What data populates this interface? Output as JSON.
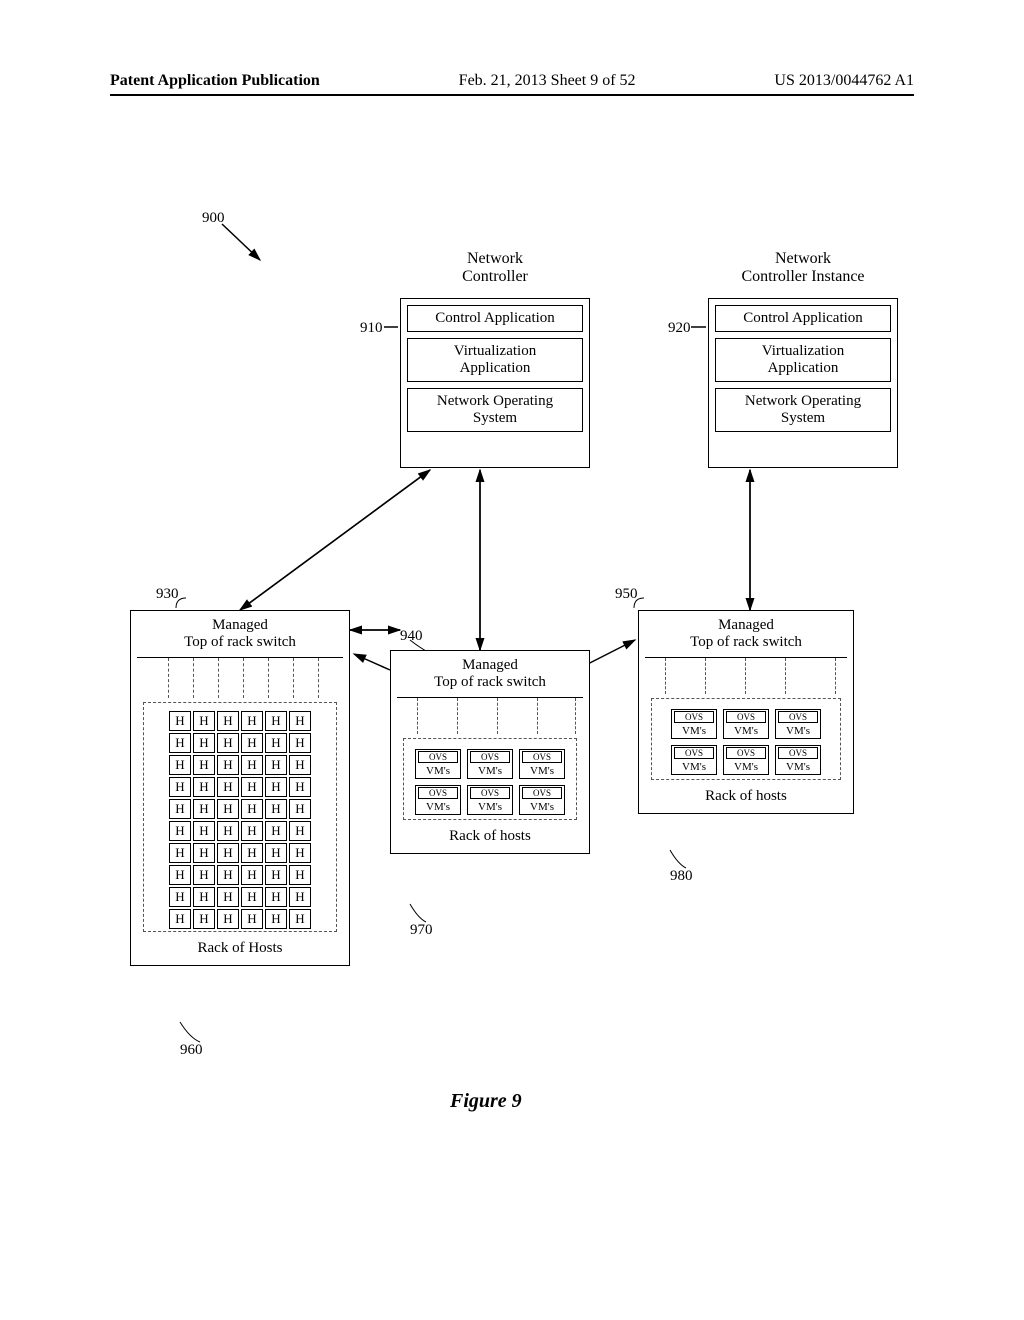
{
  "header": {
    "left": "Patent Application Publication",
    "center": "Feb. 21, 2013  Sheet 9 of 52",
    "right": "US 2013/0044762 A1"
  },
  "refnums": {
    "n900": "900",
    "n910": "910",
    "n920": "920",
    "n930": "930",
    "n940": "940",
    "n950": "950",
    "n960": "960",
    "n970": "970",
    "n980": "980"
  },
  "ctrl1": {
    "title": "Network\nController",
    "row1": "Control Application",
    "row2": "Virtualization\nApplication",
    "row3": "Network Operating\nSystem"
  },
  "ctrl2": {
    "title": "Network\nController Instance",
    "row1": "Control Application",
    "row2": "Virtualization\nApplication",
    "row3": "Network Operating\nSystem"
  },
  "sw930": {
    "title": "Managed\nTop of rack switch",
    "rack_label": "Rack of Hosts",
    "h": "H"
  },
  "sw940": {
    "title": "Managed\nTop of rack switch",
    "rack_label": "Rack of hosts",
    "ovs": "OVS",
    "vms": "VM's"
  },
  "sw950": {
    "title": "Managed\nTop of rack switch",
    "rack_label": "Rack of hosts",
    "ovs": "OVS",
    "vms": "VM's"
  },
  "figure_caption": "Figure 9"
}
